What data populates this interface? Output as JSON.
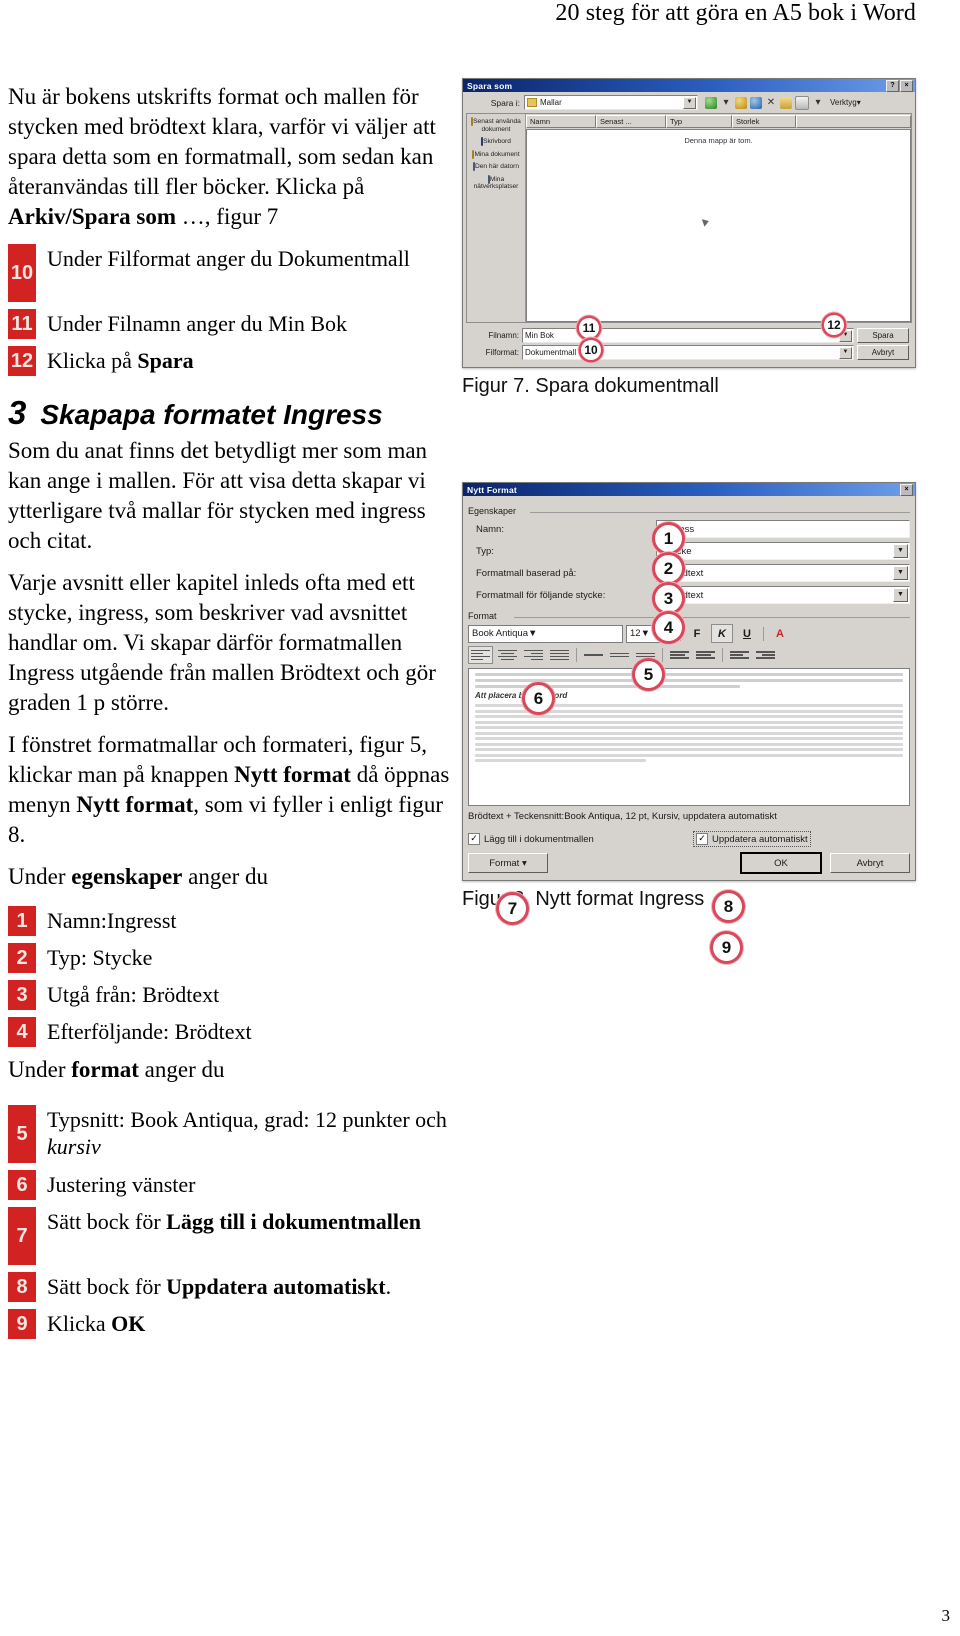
{
  "document": {
    "running_head": "20 steg för att göra en A5 bok i Word",
    "page_number": "3"
  },
  "left_column": {
    "intro_paragraph_1": "Nu är bokens utskrifts format och mallen för stycken med brödtext klara, varför vi väljer att  spara detta som en formatmall, som sedan kan återanvändas till fler böcker.  Klicka på ",
    "intro_paragraph_1_bold": "Arkiv/Spara som",
    "intro_paragraph_1_tail": " …, figur 7",
    "steps_top": [
      {
        "num": "10",
        "text_before": "Under Filformat anger du Dokumentmall",
        "bold": "",
        "text_after": ""
      },
      {
        "num": "11",
        "text_before": "Under Filnamn anger du Min Bok",
        "bold": "",
        "text_after": ""
      },
      {
        "num": "12",
        "text_before": "Klicka på ",
        "bold": "Spara",
        "text_after": ""
      }
    ],
    "section": {
      "number": "3",
      "title": "Skapapa formatet Ingress"
    },
    "paragraph_2": "Som du anat finns det betydligt mer som man kan ange i mallen. För att visa detta skapar vi ytterligare två mallar för stycken med ingress och citat.",
    "paragraph_3": "Varje avsnitt eller kapitel inleds ofta med ett stycke, ingress, som beskriver vad avsnittet handlar om. Vi skapar därför formatmallen Ingress utgående från mallen Brödtext och gör graden 1 p större.",
    "paragraph_4_a": "I fönstret formatmallar och formateri, figur 5, klickar man på knappen ",
    "paragraph_4_b1": "Nytt format",
    "paragraph_4_c": " då öppnas menyn ",
    "paragraph_4_b2": "Nytt format",
    "paragraph_4_d": ", som vi fyller i enligt figur 8.",
    "lead_in_egenskaper_a": "Under ",
    "lead_in_egenskaper_b": "egenskaper",
    "lead_in_egenskaper_c": " anger du",
    "steps_egenskaper": [
      {
        "num": "1",
        "text_before": "Namn:Ingresst",
        "bold": "",
        "text_after": ""
      },
      {
        "num": "2",
        "text_before": "Typ: Stycke",
        "bold": "",
        "text_after": ""
      },
      {
        "num": "3",
        "text_before": "Utgå från: Brödtext",
        "bold": "",
        "text_after": ""
      },
      {
        "num": "4",
        "text_before": "Efterföljande: Brödtext",
        "bold": "",
        "text_after": ""
      }
    ],
    "lead_in_format_a": "Under ",
    "lead_in_format_b": "format",
    "lead_in_format_c": " anger du",
    "steps_format": [
      {
        "num": "5",
        "text_before": "Typsnitt: Book Antiqua,  grad: 12 punkter och ",
        "italic": "kursiv",
        "text_after": ""
      },
      {
        "num": "6",
        "text_before": "Justering vänster",
        "bold": "",
        "text_after": ""
      },
      {
        "num": "7",
        "text_before": "Sätt bock för ",
        "bold": "Lägg till i dokumentmallen",
        "text_after": ""
      },
      {
        "num": "8",
        "text_before": "Sätt bock för ",
        "bold": "Uppdatera automatiskt",
        "text_after": "."
      },
      {
        "num": "9",
        "text_before": "Klicka ",
        "bold": "OK",
        "text_after": ""
      }
    ]
  },
  "figure7": {
    "caption": "Figur 7. Spara dokumentmall",
    "dialog": {
      "title": "Spara som",
      "minimize_label": "?",
      "close_label": "×",
      "save_in_label": "Spara i:",
      "save_in_value": "Mallar",
      "toolbar_last_label": "Verktyg",
      "toolbar_dropdown_arrow": "▾",
      "columns": [
        "Namn",
        "Senast ...",
        "Typ",
        "Storlek"
      ],
      "empty_message": "Denna mapp är tom.",
      "places": [
        "Senast använda dokument",
        "Skrivbord",
        "Mina dokument",
        "Den här datorn",
        "Mina nätverksplatser"
      ],
      "filename_label": "Filnamn:",
      "filename_value": "Min Bok",
      "filetype_label": "Filformat:",
      "filetype_value": "Dokumentmall",
      "save_button": "Spara",
      "cancel_button": "Avbryt",
      "callouts": [
        "10",
        "11",
        "12"
      ]
    }
  },
  "figure8": {
    "caption": "Figur 8.  Nytt format Ingress",
    "dialog": {
      "title": "Nytt Format",
      "close_label": "×",
      "group_properties": "Egenskaper",
      "group_format": "Format",
      "fields": [
        {
          "label": "Namn:",
          "value": "Ingress",
          "pilcrow": "",
          "callout": "1"
        },
        {
          "label": "Typ:",
          "value": "Stycke",
          "pilcrow": "",
          "callout": "2"
        },
        {
          "label": "Formatmall baserad på:",
          "value": "Brödtext",
          "pilcrow": "¶",
          "callout": "3"
        },
        {
          "label": "Formatmall för följande stycke:",
          "value": "Brödtext",
          "pilcrow": "¶",
          "callout": "4"
        }
      ],
      "font_name": "Book Antiqua",
      "font_size": "12",
      "bold_button": "F",
      "italic_button": "K",
      "underline_button": "U",
      "color_button": "A",
      "callout_font": "5",
      "callout_align": "6",
      "preview_sample_text": "Att placera bilder i Word",
      "description": "Brödtext + Teckensnitt:Book Antiqua, 12 pt, Kursiv, uppdatera automatiskt",
      "checkbox_add_to_template": "Lägg till i dokumentmallen",
      "checkbox_auto_update": "Uppdatera automatiskt",
      "checkbox_mark": "✓",
      "callout_add_to_template": "7",
      "callout_auto_update": "8",
      "format_button": "Format",
      "format_button_arrow": "▾",
      "ok_button": "OK",
      "cancel_button": "Avbryt",
      "callout_ok": "9"
    }
  },
  "colors": {
    "step_badge": "#d32222",
    "callout_ring": "#d9485a",
    "titlebar": "#0a246a",
    "dialog_face": "#d6d3ce"
  }
}
